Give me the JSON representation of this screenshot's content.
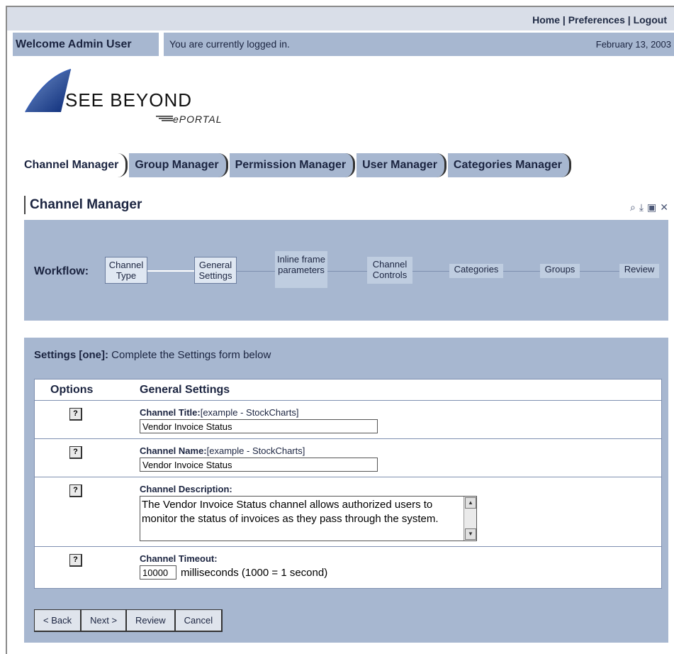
{
  "topnav": {
    "home": "Home",
    "preferences": "Preferences",
    "logout": "Logout",
    "sep": "|"
  },
  "welcome": "Welcome Admin User",
  "status": {
    "message": "You are currently logged in.",
    "date": "February 13, 2003"
  },
  "logo": {
    "brand": "SEE BEYOND",
    "product": "ePORTAL"
  },
  "tabs": [
    {
      "label": "Channel Manager"
    },
    {
      "label": "Group Manager"
    },
    {
      "label": "Permission Manager"
    },
    {
      "label": "User Manager"
    },
    {
      "label": "Categories Manager"
    }
  ],
  "section": {
    "title": "Channel Manager"
  },
  "workflow": {
    "label": "Workflow:",
    "steps": [
      {
        "label": "Channel Type"
      },
      {
        "label": "General Settings"
      },
      {
        "label": "Inline frame parameters"
      },
      {
        "label": "Channel Controls"
      },
      {
        "label": "Categories"
      },
      {
        "label": "Groups"
      },
      {
        "label": "Review"
      }
    ]
  },
  "settings": {
    "title_bold": "Settings [one]:",
    "title_rest": " Complete the Settings form below",
    "col_options": "Options",
    "col_general": "General Settings",
    "help_glyph": "?",
    "fields": {
      "title": {
        "label": "Channel Title:",
        "hint": "[example - StockCharts]",
        "value": "Vendor Invoice Status"
      },
      "name": {
        "label": "Channel Name:",
        "hint": "[example - StockCharts]",
        "value": "Vendor Invoice Status"
      },
      "description": {
        "label": "Channel Description:",
        "value": "The Vendor Invoice Status channel allows authorized users to monitor the status of invoices as they pass through the system."
      },
      "timeout": {
        "label": "Channel Timeout:",
        "value": "10000",
        "unit": "milliseconds (1000 = 1 second)"
      }
    }
  },
  "buttons": {
    "back": "< Back",
    "next": "Next >",
    "review": "Review",
    "cancel": "Cancel"
  }
}
